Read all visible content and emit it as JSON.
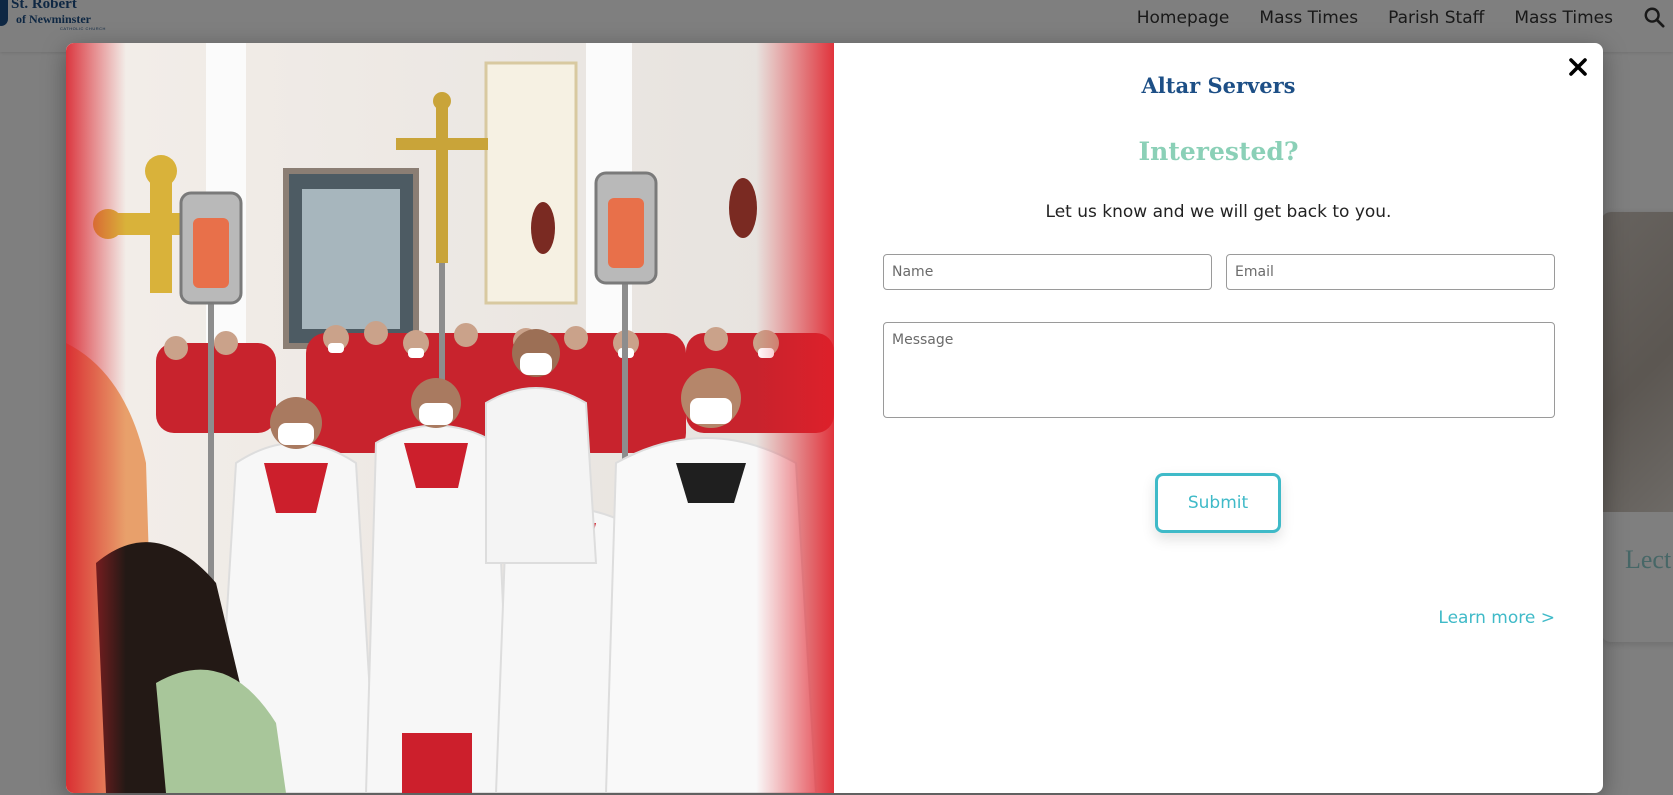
{
  "site": {
    "logo": {
      "line1": "St. Robert",
      "line2": "of Newminster",
      "line3": "CATHOLIC CHURCH"
    },
    "nav": {
      "items": [
        {
          "label": "Homepage"
        },
        {
          "label": "Mass Times"
        },
        {
          "label": "Parish Staff"
        },
        {
          "label": "Mass Times"
        }
      ],
      "search_icon": "search-icon"
    },
    "background_card": {
      "title": "Lect"
    }
  },
  "modal": {
    "image_description": "altar-servers-procession-photo",
    "close_icon": "close-icon",
    "heading": "Altar Servers",
    "subheading": "Interested?",
    "intro": "Let us know and we will get back to you.",
    "form": {
      "name_placeholder": "Name",
      "email_placeholder": "Email",
      "message_placeholder": "Message",
      "submit_label": "Submit"
    },
    "learn_more": "Learn more >"
  },
  "colors": {
    "brand_blue": "#1d4f86",
    "accent_teal": "#3fbac8",
    "accent_mint": "#8bd0b7",
    "overlay": "rgba(0,0,0,0.5)"
  }
}
